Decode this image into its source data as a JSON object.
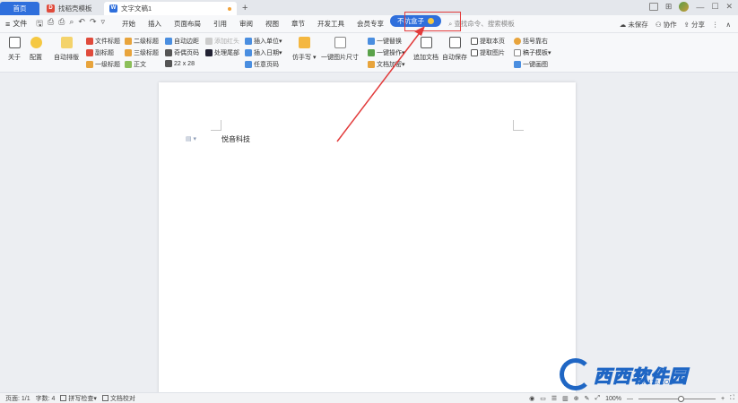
{
  "titlebar": {
    "tabs": [
      {
        "label": "首页"
      },
      {
        "label": "找稻壳模板"
      },
      {
        "label": "文字文稿1"
      }
    ],
    "new_tab": "+"
  },
  "menubar": {
    "file_label": "文件",
    "items": [
      "开始",
      "插入",
      "页面布局",
      "引用",
      "审阅",
      "视图",
      "章节",
      "开发工具",
      "会员专享",
      "不坑盒子"
    ],
    "search_placeholder": "查找命令、搜索模板",
    "unsaved": "未保存",
    "collab": "协作",
    "share": "分享"
  },
  "ribbon": {
    "about": "关于",
    "config": "配置",
    "auto_layout": "自动排版",
    "h_file_title": "文件标题",
    "h_second": "二级标题",
    "auto_margin": "自动边距",
    "add_header": "添加红头",
    "insert_unit": "插入单位",
    "sub_title": "副标题",
    "third": "三级标题",
    "odd_even": "奇偶页码",
    "process_tail": "处理尾部",
    "insert_date": "插入日期",
    "first": "一级标题",
    "body": "正文",
    "grid": "22 x 28",
    "any_page": "任意页码",
    "handwrite": "仿手写",
    "img_size": "一键图片尺寸",
    "one_click_a": "一键替换",
    "one_click_b": "一键操作",
    "text_plus": "文档加密",
    "add_doc": "追加文档",
    "auto_save": "自动保存",
    "extract_page": "提取本页",
    "extract_img": "提取图片",
    "bracket": "括号靠右",
    "paper_tpl": "稿子模板",
    "one_click_draw": "一键画图"
  },
  "document": {
    "body_text": "悦音科技"
  },
  "watermark": {
    "brand": "西西软件园",
    "url": "CR173.COM"
  },
  "status": {
    "page": "页面: 1/1",
    "words": "字数: 4",
    "spell": "拼写检查",
    "proof": "文档校对",
    "zoom": "100%"
  },
  "colors": {
    "accent": "#2f6fdc",
    "highlight": "#e23b3b"
  }
}
